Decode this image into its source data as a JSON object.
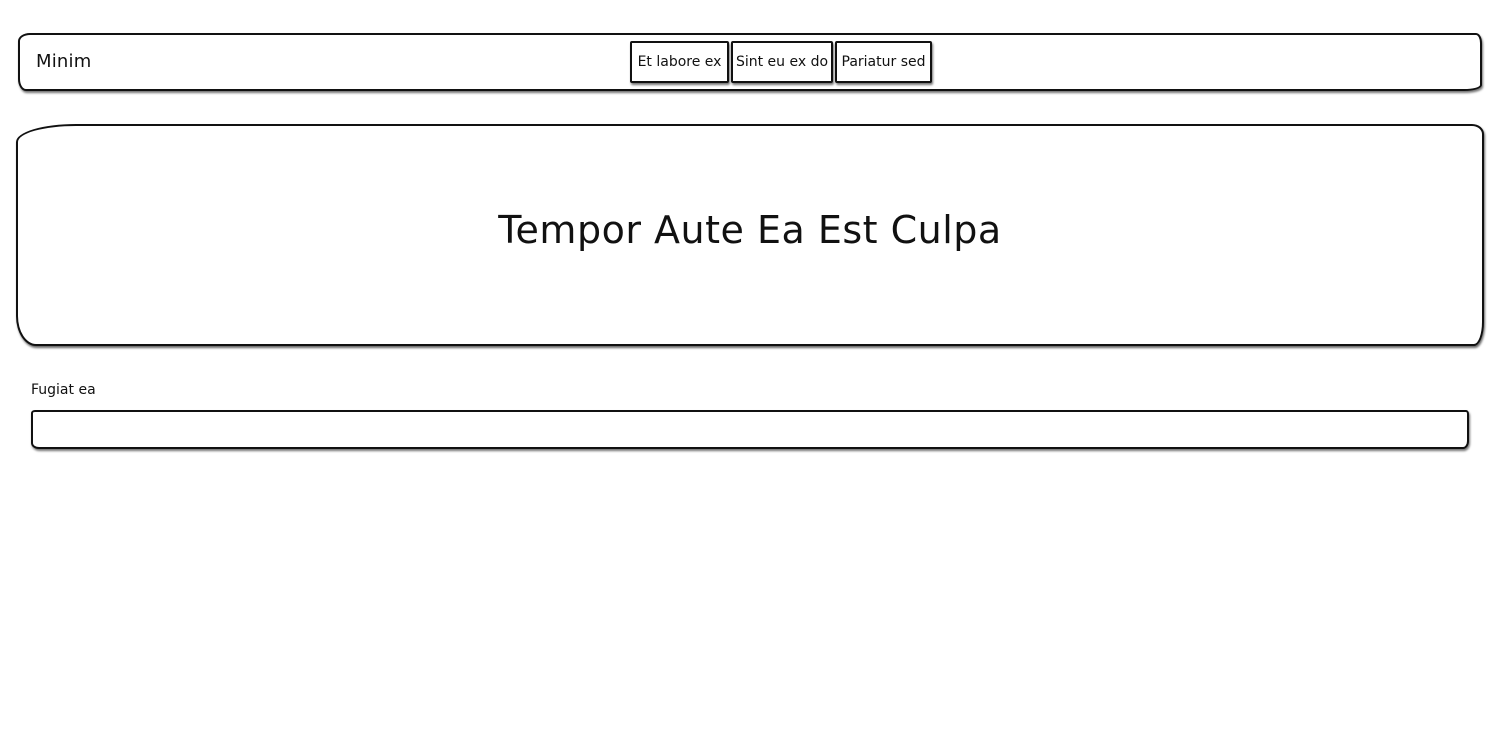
{
  "navbar": {
    "brand": "Minim",
    "links": [
      {
        "label": "Et labore ex"
      },
      {
        "label": "Sint eu ex do"
      },
      {
        "label": "Pariatur sed"
      }
    ]
  },
  "hero": {
    "title": "Tempor Aute Ea Est Culpa"
  },
  "form": {
    "field_label": "Fugiat ea",
    "field_value": "",
    "field_placeholder": ""
  }
}
